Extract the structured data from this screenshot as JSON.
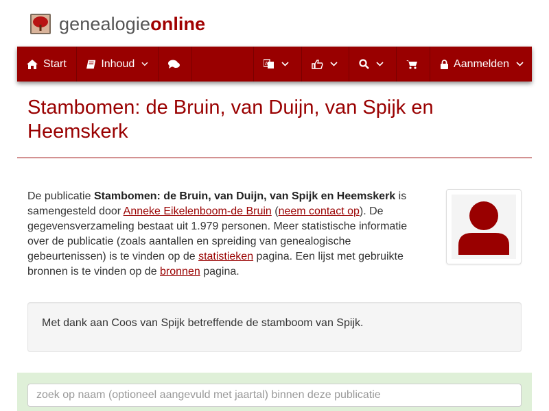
{
  "brand": {
    "name_part1": "genealogie",
    "name_part2": "online"
  },
  "nav": {
    "start_label": "Start",
    "inhoud_label": "Inhoud",
    "aanmelden_label": "Aanmelden"
  },
  "page": {
    "title": "Stambomen: de Bruin, van Duijn, van Spijk en Heemskerk"
  },
  "intro": {
    "t1": "De publicatie ",
    "pub_title": "Stambomen: de Bruin, van Duijn, van Spijk en Heemskerk",
    "t2": " is samengesteld door ",
    "author_link": "Anneke Eikelenboom-de Bruin",
    "t3": " (",
    "contact_link": "neem contact op",
    "t4": "). De gegevensverzameling bestaat uit 1.979 personen. Meer statistische informatie over de publicatie (zoals aantallen en spreiding van genealogische gebeurtenissen) is te vinden op de ",
    "stats_link": "statistieken",
    "t5": " pagina. Een lijst met gebruikte bronnen is te vinden op de ",
    "sources_link": "bronnen",
    "t6": " pagina."
  },
  "thanks": {
    "text": "Met dank aan Coos van Spijk betreffende de stamboom van Spijk."
  },
  "search": {
    "placeholder": "zoek op naam (optioneel aangevuld met jaartal) binnen deze publicatie"
  },
  "icons": {
    "logo": "tree-logo-icon",
    "home": "home-icon",
    "book": "book-icon",
    "comments": "comments-icon",
    "language": "language-icon",
    "thumbs": "thumbs-up-icon",
    "search": "search-icon",
    "cart": "cart-icon",
    "lock": "lock-icon",
    "avatar": "user-avatar-icon"
  },
  "colors": {
    "brand": "#990000",
    "search_band": "#dff0d8"
  }
}
